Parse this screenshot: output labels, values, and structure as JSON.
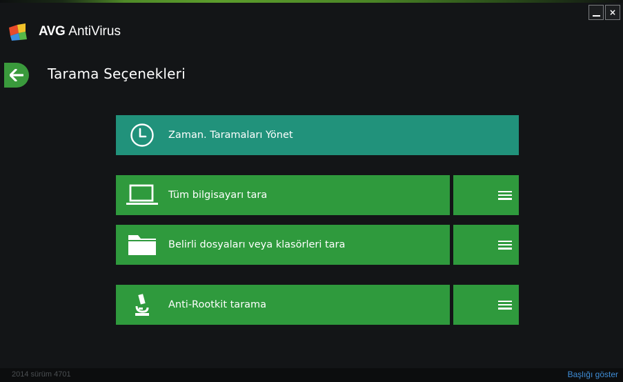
{
  "app": {
    "brand": "AVG",
    "product": "AntiVirus"
  },
  "window_controls": {
    "minimize_icon": "minimize-icon",
    "close_label": "×"
  },
  "page": {
    "title": "Tarama Seçenekleri"
  },
  "options": [
    {
      "label": "Zaman. Taramaları Yönet",
      "icon": "clock-icon",
      "color": "#21927b",
      "has_menu": false
    },
    {
      "label": "Tüm bilgisayarı tara",
      "icon": "laptop-icon",
      "color": "#2f9a3d",
      "has_menu": true
    },
    {
      "label": "Belirli dosyaları veya klasörleri tara",
      "icon": "folder-icon",
      "color": "#2f9a3d",
      "has_menu": true
    },
    {
      "label": "Anti-Rootkit tarama",
      "icon": "microscope-icon",
      "color": "#2f9a3d",
      "has_menu": true
    }
  ],
  "footer": {
    "version": "2014  sürüm 4701",
    "show_title_link": "Başlığı göster",
    "link_color": "#3f8ed8"
  },
  "colors": {
    "background": "#131517",
    "accent_green": "#2f9a3d",
    "accent_teal": "#21927b"
  }
}
